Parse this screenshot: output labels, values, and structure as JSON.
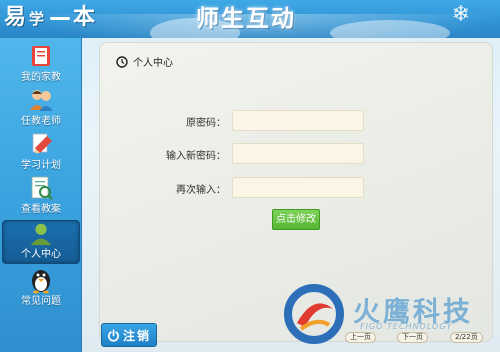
{
  "header": {
    "logo_main": "易",
    "logo_mid": "学",
    "logo_end": "本",
    "title": "师生互动"
  },
  "sidebar": {
    "items": [
      {
        "label": "我的家教",
        "icon": "book-icon"
      },
      {
        "label": "任教老师",
        "icon": "teachers-icon"
      },
      {
        "label": "学习计划",
        "icon": "pencil-icon"
      },
      {
        "label": "查看教案",
        "icon": "document-icon"
      },
      {
        "label": "个人中心",
        "icon": "user-icon",
        "active": true
      },
      {
        "label": "常见问题",
        "icon": "penguin-icon"
      }
    ]
  },
  "panel": {
    "title": "个人中心",
    "fields": [
      {
        "label": "原密码：",
        "value": ""
      },
      {
        "label": "输入新密码：",
        "value": ""
      },
      {
        "label": "再次输入：",
        "value": ""
      }
    ],
    "submit_label": "点击修改"
  },
  "brand": {
    "name_cn": "火鹰科技",
    "name_en": "FIGO TECHNOLOGY"
  },
  "pager": {
    "prev": "上一页",
    "next": "下一页",
    "page": "2/22页"
  },
  "logout_label": "注销",
  "colors": {
    "header": "#2f93d4",
    "sidebar": "#3aa3df",
    "active_item": "#155d95",
    "submit": "#54b531",
    "input_bg": "#fbf5e6"
  }
}
